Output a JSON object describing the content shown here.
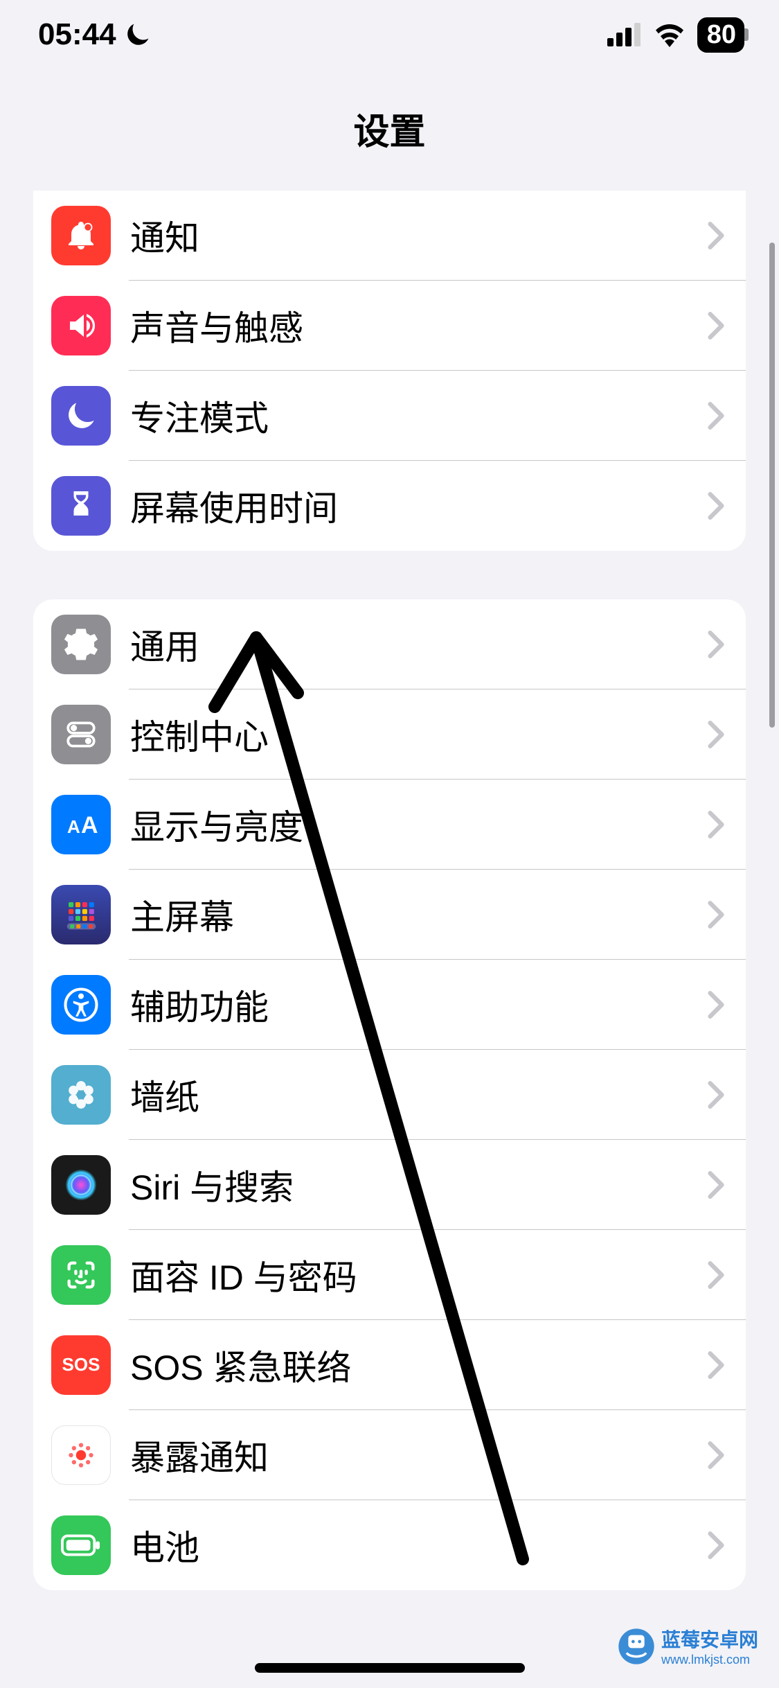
{
  "status_bar": {
    "time": "05:44",
    "battery": "80"
  },
  "header": {
    "title": "设置"
  },
  "groups": [
    {
      "items": [
        {
          "key": "notifications",
          "label": "通知",
          "icon": "bell-icon",
          "color": "#ff3b30"
        },
        {
          "key": "sounds",
          "label": "声音与触感",
          "icon": "speaker-icon",
          "color": "#ff2d55"
        },
        {
          "key": "focus",
          "label": "专注模式",
          "icon": "moon-icon",
          "color": "#5856d6"
        },
        {
          "key": "screen-time",
          "label": "屏幕使用时间",
          "icon": "hourglass-icon",
          "color": "#5856d6"
        }
      ]
    },
    {
      "items": [
        {
          "key": "general",
          "label": "通用",
          "icon": "gear-icon",
          "color": "#8e8e93"
        },
        {
          "key": "control-center",
          "label": "控制中心",
          "icon": "switches-icon",
          "color": "#8e8e93"
        },
        {
          "key": "display",
          "label": "显示与亮度",
          "icon": "text-size-icon",
          "color": "#007aff"
        },
        {
          "key": "home-screen",
          "label": "主屏幕",
          "icon": "app-grid-icon",
          "color": "#3a3a8e"
        },
        {
          "key": "accessibility",
          "label": "辅助功能",
          "icon": "accessibility-icon",
          "color": "#007aff"
        },
        {
          "key": "wallpaper",
          "label": "墙纸",
          "icon": "flower-icon",
          "color": "#34aadc"
        },
        {
          "key": "siri",
          "label": "Siri 与搜索",
          "icon": "siri-icon",
          "color": "#1a1a1a"
        },
        {
          "key": "face-id",
          "label": "面容 ID 与密码",
          "icon": "faceid-icon",
          "color": "#34c759"
        },
        {
          "key": "sos",
          "label": "SOS 紧急联络",
          "icon": "sos-icon",
          "color": "#ff3b30"
        },
        {
          "key": "exposure",
          "label": "暴露通知",
          "icon": "exposure-icon",
          "color": "#ffffff"
        },
        {
          "key": "battery",
          "label": "电池",
          "icon": "battery-icon",
          "color": "#34c759"
        }
      ]
    }
  ],
  "watermark": {
    "title": "蓝莓安卓网",
    "url": "www.lmkjst.com"
  }
}
